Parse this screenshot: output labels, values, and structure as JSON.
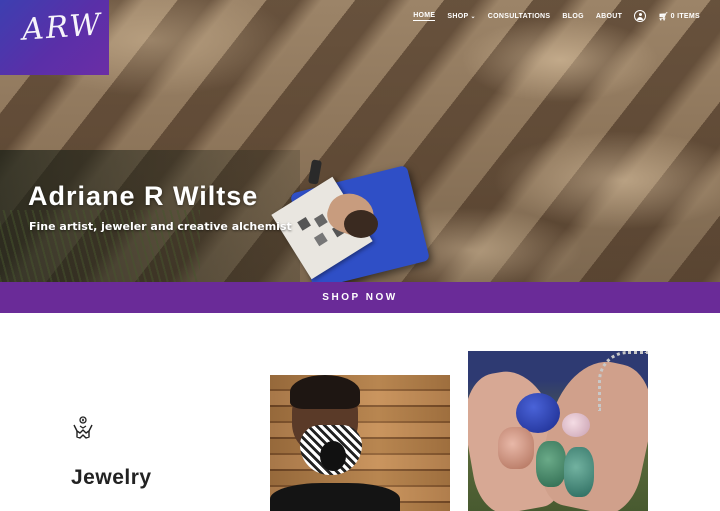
{
  "logo": {
    "text": "ARW",
    "icon": "arw-signature-logo"
  },
  "nav": {
    "items": [
      {
        "label": "HOME",
        "active": true
      },
      {
        "label": "SHOP",
        "caret": "⌄"
      },
      {
        "label": "CONSULTATIONS"
      },
      {
        "label": "BLOG"
      },
      {
        "label": "ABOUT"
      }
    ],
    "account_icon": "user-icon",
    "cart": {
      "icon": "cart-icon",
      "label": "0 ITEMS"
    }
  },
  "hero": {
    "title": "Adriane R Wiltse",
    "subtitle": "Fine artist, jeweler and creative alchemist"
  },
  "shop_bar": {
    "label": "SHOP NOW"
  },
  "jewelry": {
    "title": "Jewelry",
    "icon": "hands-gem-icon"
  },
  "colors": {
    "brand_purple": "#6a2b98",
    "logo_gradient_start": "#3d3fb0",
    "logo_gradient_end": "#6b2ea6"
  }
}
